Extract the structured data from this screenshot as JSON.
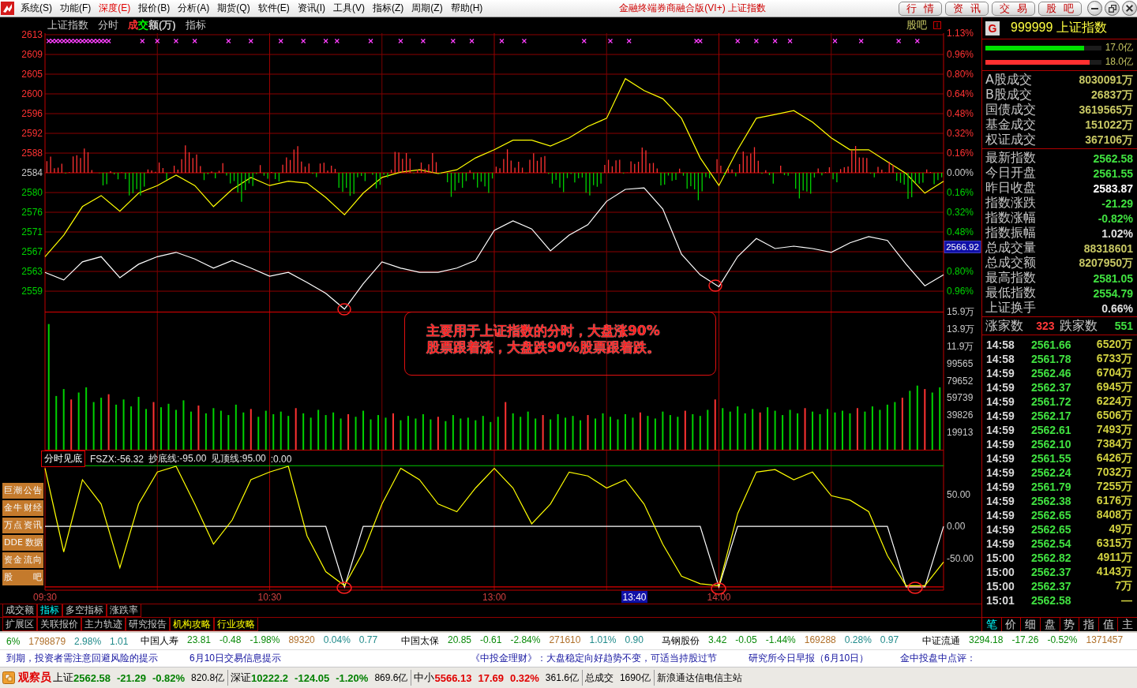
{
  "menu_bar": {
    "items": [
      {
        "label": "系统(S)",
        "highlighted": false
      },
      {
        "label": "功能(F)",
        "highlighted": false
      },
      {
        "label": "深度(E)",
        "highlighted": true
      },
      {
        "label": "报价(B)",
        "highlighted": false
      },
      {
        "label": "分析(A)",
        "highlighted": false
      },
      {
        "label": "期货(Q)",
        "highlighted": false
      },
      {
        "label": "软件(E)",
        "highlighted": false
      },
      {
        "label": "资讯(I)",
        "highlighted": false
      },
      {
        "label": "工具(V)",
        "highlighted": false
      },
      {
        "label": "指标(Z)",
        "highlighted": false
      },
      {
        "label": "周期(Z)",
        "highlighted": false
      },
      {
        "label": "帮助(H)",
        "highlighted": false
      }
    ],
    "title": "金融终端券商融合版(VI+) 上证指数",
    "buttons": [
      "行情",
      "资讯",
      "交易",
      "股吧"
    ]
  },
  "chart_header": {
    "title": "上证指数",
    "mode": "分时",
    "legend_parts": [
      {
        "text": "成",
        "color": "#ff3232"
      },
      {
        "text": "交",
        "color": "#00ff00"
      },
      {
        "text": "额(万)",
        "color": "#c8c8c8"
      }
    ],
    "indicator": "指标",
    "forum": "股吧"
  },
  "price_chart": {
    "cursor_label": "2566.92",
    "chart_data": {
      "type": "line",
      "grid": true,
      "categories": [
        null,
        null,
        null,
        null,
        null,
        null,
        null,
        null,
        null,
        null,
        null,
        null,
        null,
        null,
        null,
        null,
        null,
        null,
        null,
        null,
        null,
        null,
        null,
        null,
        null,
        null,
        null,
        null,
        null,
        null,
        null,
        null,
        null,
        null,
        null,
        null,
        null,
        null,
        null,
        null,
        null,
        null,
        null,
        null,
        null,
        null,
        null,
        null,
        null
      ],
      "ylim": [
        2554.77,
        2613.14
      ],
      "y2lim": [
        -1.126,
        1.133
      ],
      "yticks": [
        {
          "value": 2612.81,
          "label": "2613"
        },
        {
          "value": 2608.67,
          "label": "2609"
        },
        {
          "value": 2604.54,
          "label": "2605"
        },
        {
          "value": 2600.41,
          "label": "2600"
        },
        {
          "value": 2596.27,
          "label": "2596"
        },
        {
          "value": 2592.14,
          "label": "2592"
        },
        {
          "value": 2588.0,
          "label": "2588"
        },
        {
          "value": 2583.87,
          "label": "2584"
        },
        {
          "value": 2579.73,
          "label": "2580"
        },
        {
          "value": 2575.6,
          "label": "2576"
        },
        {
          "value": 2571.47,
          "label": "2571"
        },
        {
          "value": 2567.33,
          "label": "2567"
        },
        {
          "value": 2563.2,
          "label": "2563"
        },
        {
          "value": 2559.06,
          "label": "2559"
        }
      ],
      "y2ticks": [
        {
          "value": 1.13,
          "label": "1.13%"
        },
        {
          "value": 0.96,
          "label": "0.96%"
        },
        {
          "value": 0.8,
          "label": "0.80%"
        },
        {
          "value": 0.64,
          "label": "0.64%"
        },
        {
          "value": 0.48,
          "label": "0.48%"
        },
        {
          "value": 0.32,
          "label": "0.32%"
        },
        {
          "value": 0.16,
          "label": "0.16%"
        },
        {
          "value": 0,
          "label": "0.00%"
        },
        {
          "value": -0.16,
          "label": "0.16%"
        },
        {
          "value": -0.32,
          "label": "0.32%"
        },
        {
          "value": -0.48,
          "label": "0.48%"
        },
        {
          "value": -0.8,
          "label": "0.80%"
        },
        {
          "value": -0.96,
          "label": "0.96%"
        }
      ],
      "series": [
        {
          "color": "#ffff00",
          "values": [
            2566.3,
            2570.8,
            2576.8,
            2579.1,
            2575.8,
            2579.6,
            2581.2,
            2583.4,
            2581.2,
            2576.8,
            2580.4,
            2582.9,
            2581.2,
            2582.1,
            2581.7,
            2578.7,
            2575.1,
            2579.6,
            2582.9,
            2584.0,
            2584.5,
            2583.7,
            2584.5,
            2587.0,
            2588.7,
            2590.7,
            2590.7,
            2589.5,
            2591.2,
            2593.6,
            2595.3,
            2603.6,
            2601.1,
            2599.4,
            2595.3,
            2587.0,
            2581.2,
            2588.7,
            2595.3,
            2596.1,
            2596.9,
            2594.5,
            2591.2,
            2588.7,
            2588.7,
            2586.2,
            2583.7,
            2579.6,
            2582.1
          ]
        },
        {
          "color": "#ffffff",
          "values": [
            2563.0,
            2561.4,
            2565.2,
            2566.3,
            2561.9,
            2564.7,
            2566.3,
            2567.2,
            2565.8,
            2563.9,
            2565.5,
            2563.9,
            2562.2,
            2563.0,
            2560.9,
            2558.6,
            2555.3,
            2560.6,
            2565.2,
            2563.9,
            2563.0,
            2563.0,
            2563.9,
            2565.5,
            2571.8,
            2573.8,
            2572.1,
            2567.5,
            2570.8,
            2573.0,
            2577.9,
            2580.4,
            2580.7,
            2576.3,
            2566.8,
            2562.5,
            2560.0,
            2566.3,
            2570.1,
            2568.0,
            2568.5,
            2568.0,
            2567.2,
            2569.2,
            2570.5,
            2569.7,
            2564.7,
            2560.2,
            2562.5
          ]
        }
      ],
      "ref_lines": [
        {
          "axis": "y",
          "value": 2583.87,
          "color": "#a00000"
        }
      ]
    }
  },
  "volume_chart": {
    "note": {
      "lines": [
        "主要用于上证指数的分时，大盘涨90%",
        "股票跟着涨，大盘跌90%股票跟着跌。"
      ]
    },
    "chart_data": {
      "type": "bar",
      "stacked": true,
      "grid": true,
      "ylim": [
        0,
        159304
      ],
      "y2lim": [
        0,
        15.9
      ],
      "yticks": [
        {
          "value": 19913,
          "label": "19913"
        },
        {
          "value": 39826,
          "label": "39826"
        },
        {
          "value": 59739,
          "label": "59739"
        },
        {
          "value": 79652,
          "label": "79652"
        },
        {
          "value": 99565,
          "label": "99565"
        }
      ],
      "y2ticks": [
        {
          "value": 11.9,
          "label": "11.9万"
        },
        {
          "value": 13.9,
          "label": "13.9万"
        },
        {
          "value": 15.9,
          "label": "15.9万"
        }
      ],
      "series": [
        {
          "color": "#ff3232",
          "values": [
            null,
            null,
            null,
            58000,
            null,
            null,
            null,
            null,
            64000,
            null,
            null,
            null,
            null,
            null,
            55000,
            null,
            null,
            null,
            null,
            null,
            51000,
            null,
            null,
            null,
            null,
            null,
            null,
            47000,
            null,
            null,
            null,
            null,
            null,
            48000,
            null,
            null,
            null,
            null,
            null,
            null,
            41000,
            null,
            null,
            null,
            null,
            null,
            42000,
            null,
            null,
            null,
            null,
            null,
            38000,
            null,
            null,
            null,
            null,
            null,
            null,
            null,
            null,
            55000,
            null,
            null,
            null,
            null,
            40000,
            null,
            null,
            null,
            null,
            null,
            40000,
            null,
            null,
            null,
            null,
            null,
            null,
            43000,
            null,
            null,
            null,
            null,
            null,
            45000,
            null,
            null,
            null,
            58000,
            null,
            null,
            null,
            null,
            null,
            43000,
            null,
            null,
            null,
            null,
            null,
            48000,
            null,
            null,
            null,
            null,
            null,
            null,
            48000,
            null,
            null,
            null,
            null,
            null,
            60000,
            null,
            null,
            70000,
            null,
            null
          ]
        },
        {
          "color": "#00d200",
          "values": [
            145000,
            62000,
            70000,
            null,
            66000,
            72000,
            55000,
            60000,
            null,
            52000,
            58000,
            50000,
            61000,
            47000,
            null,
            49000,
            53000,
            46000,
            57000,
            44000,
            null,
            42000,
            48000,
            45000,
            40000,
            52000,
            43000,
            null,
            38000,
            45000,
            41000,
            44000,
            39000,
            null,
            42000,
            37000,
            46000,
            40000,
            43000,
            36000,
            null,
            38000,
            45000,
            35000,
            40000,
            37000,
            null,
            34000,
            39000,
            36000,
            41000,
            35000,
            null,
            33000,
            40000,
            36000,
            37000,
            34000,
            39000,
            32000,
            38000,
            null,
            42000,
            38000,
            44000,
            36000,
            null,
            35000,
            41000,
            37000,
            39000,
            34000,
            null,
            36000,
            42000,
            38000,
            35000,
            41000,
            37000,
            null,
            39000,
            36000,
            44000,
            40000,
            38000,
            null,
            41000,
            39000,
            46000,
            null,
            48000,
            44000,
            50000,
            42000,
            47000,
            null,
            49000,
            45000,
            40000,
            46000,
            42000,
            null,
            44000,
            41000,
            47000,
            43000,
            45000,
            42000,
            null,
            44000,
            50000,
            46000,
            52000,
            55000,
            null,
            68000,
            74000,
            null,
            66000,
            72000
          ]
        }
      ]
    }
  },
  "indicator_chart": {
    "label": "分时见底",
    "legend": [
      "FSZX:-56.32",
      "抄底线:-95.00",
      "见顶线:95.00",
      ":0.00"
    ],
    "cursor_time": "13:40",
    "chart_data": {
      "type": "line",
      "grid": true,
      "categories": [
        "09:30",
        null,
        null,
        null,
        null,
        null,
        null,
        null,
        null,
        null,
        null,
        null,
        "10:30",
        null,
        null,
        null,
        null,
        null,
        null,
        null,
        null,
        null,
        null,
        null,
        "13:00",
        null,
        null,
        null,
        null,
        null,
        null,
        null,
        null,
        null,
        null,
        null,
        "14:00",
        null,
        null,
        null,
        null,
        null,
        null,
        null,
        null,
        null,
        null,
        null,
        null
      ],
      "ylim": [
        -100,
        120
      ],
      "yticks": [
        {
          "value": 50,
          "label": "50.00"
        },
        {
          "value": 0,
          "label": "0.00"
        },
        {
          "value": -50,
          "label": "-50.00"
        }
      ],
      "series": [
        {
          "color": "#ffffff",
          "values": [
            0,
            0,
            0,
            0,
            0,
            0,
            0,
            0,
            0,
            0,
            0,
            0,
            0,
            0,
            0,
            0,
            -95,
            0,
            0,
            0,
            0,
            0,
            0,
            0,
            0,
            0,
            0,
            0,
            0,
            0,
            0,
            0,
            0,
            0,
            0,
            0,
            -95,
            0,
            0,
            0,
            0,
            0,
            0,
            0,
            0,
            0,
            -95,
            -95,
            0
          ]
        },
        {
          "color": "#ffff00",
          "values": [
            91,
            -40,
            73,
            35,
            -65,
            35,
            85,
            94,
            35,
            -28,
            10,
            73,
            85,
            94,
            -15,
            -71,
            -93,
            -40,
            35,
            91,
            73,
            35,
            23,
            60,
            91,
            60,
            4,
            35,
            85,
            79,
            60,
            73,
            35,
            -28,
            -78,
            -90,
            -93,
            20,
            85,
            89,
            73,
            85,
            48,
            41,
            23,
            -46,
            -93,
            -93,
            -56
          ]
        }
      ],
      "ref_lines": [
        {
          "axis": "y",
          "value": 95,
          "color": "#00c800"
        },
        {
          "axis": "y",
          "value": -95,
          "color": "#e00000"
        }
      ]
    }
  },
  "side_buttons": [
    "巨潮公告",
    "金牛财经",
    "万点资讯",
    "DDE 数据",
    "资金流向",
    "股吧"
  ],
  "chart_tabs": [
    {
      "label": "成交额",
      "selected": false
    },
    {
      "label": "指标",
      "selected": true
    },
    {
      "label": "多空指标",
      "selected": false
    },
    {
      "label": "涨跌率",
      "selected": false
    }
  ],
  "extension_tabs": [
    {
      "label": "扩展区",
      "highlighted": false
    },
    {
      "label": "关联报价",
      "highlighted": false
    },
    {
      "label": "主力轨迹",
      "highlighted": false
    },
    {
      "label": "研究报告",
      "highlighted": false
    },
    {
      "label": "机构攻略",
      "highlighted": true
    },
    {
      "label": "行业攻略",
      "highlighted": true
    }
  ],
  "quote_panel": {
    "badge": "G",
    "title": "999999 上证指数",
    "flow_bars": [
      {
        "color": "#00e000",
        "level": 0.85,
        "value": "17.0亿"
      },
      {
        "color": "#ff3030",
        "level": 0.9,
        "value": "18.0亿"
      }
    ],
    "turnover": [
      {
        "label": "A股成交",
        "value": "8030091万"
      },
      {
        "label": "B股成交",
        "value": "26837万"
      },
      {
        "label": "国债成交",
        "value": "3619565万"
      },
      {
        "label": "基金成交",
        "value": "151022万"
      },
      {
        "label": "权证成交",
        "value": "367106万"
      }
    ],
    "stats": [
      {
        "label": "最新指数",
        "value": "2562.58",
        "color": "#40e040"
      },
      {
        "label": "今日开盘",
        "value": "2561.55",
        "color": "#40e040"
      },
      {
        "label": "昨日收盘",
        "value": "2583.87",
        "color": "#ffffff"
      },
      {
        "label": "指数涨跌",
        "value": "-21.29",
        "color": "#40e040"
      },
      {
        "label": "指数涨幅",
        "value": "-0.82%",
        "color": "#40e040"
      },
      {
        "label": "指数振幅",
        "value": "1.02%",
        "color": "#e0e0e0"
      },
      {
        "label": "总成交量",
        "value": "88318601",
        "color": "#c8c864"
      },
      {
        "label": "总成交额",
        "value": "8207950万",
        "color": "#c8c864"
      },
      {
        "label": "最高指数",
        "value": "2581.05",
        "color": "#40e040"
      },
      {
        "label": "最低指数",
        "value": "2554.79",
        "color": "#40e040"
      },
      {
        "label": "上证换手",
        "value": "0.66%",
        "color": "#e0e0e0"
      }
    ],
    "breadth": {
      "up_label": "涨家数",
      "up_count": "323",
      "down_label": "跌家数",
      "down_count": "551"
    },
    "trades": [
      {
        "time": "14:58",
        "price": "2561.66",
        "volume": "6520万"
      },
      {
        "time": "14:58",
        "price": "2561.78",
        "volume": "6733万"
      },
      {
        "time": "14:59",
        "price": "2562.46",
        "volume": "6704万"
      },
      {
        "time": "14:59",
        "price": "2562.37",
        "volume": "6945万"
      },
      {
        "time": "14:59",
        "price": "2561.72",
        "volume": "6224万"
      },
      {
        "time": "14:59",
        "price": "2562.17",
        "volume": "6506万"
      },
      {
        "time": "14:59",
        "price": "2562.61",
        "volume": "7493万"
      },
      {
        "time": "14:59",
        "price": "2562.10",
        "volume": "7384万"
      },
      {
        "time": "14:59",
        "price": "2561.55",
        "volume": "6426万"
      },
      {
        "time": "14:59",
        "price": "2562.24",
        "volume": "7032万"
      },
      {
        "time": "14:59",
        "price": "2561.79",
        "volume": "7255万"
      },
      {
        "time": "14:59",
        "price": "2562.38",
        "volume": "6176万"
      },
      {
        "time": "14:59",
        "price": "2562.65",
        "volume": "8408万"
      },
      {
        "time": "14:59",
        "price": "2562.65",
        "volume": "49万"
      },
      {
        "time": "14:59",
        "price": "2562.54",
        "volume": "6315万"
      },
      {
        "time": "15:00",
        "price": "2562.82",
        "volume": "4911万"
      },
      {
        "time": "15:00",
        "price": "2562.37",
        "volume": "4143万"
      },
      {
        "time": "15:00",
        "price": "2562.37",
        "volume": "7万"
      },
      {
        "time": "15:01",
        "price": "2562.58",
        "volume": "—"
      }
    ],
    "tabs": [
      {
        "label": "笔",
        "selected": true
      },
      {
        "label": "价",
        "selected": false
      },
      {
        "label": "细",
        "selected": false
      },
      {
        "label": "盘",
        "selected": false
      },
      {
        "label": "势",
        "selected": false
      },
      {
        "label": "指",
        "selected": false
      },
      {
        "label": "值",
        "selected": false
      },
      {
        "label": "主",
        "selected": false
      }
    ]
  },
  "ticker": [
    {
      "pct": "6%",
      "volume": "1798879",
      "turnover": "2.98%",
      "ratio": "1.01"
    },
    {
      "name": "中国人寿",
      "price": "23.81",
      "change": "-0.48",
      "pct": "-1.98%",
      "volume": "89320",
      "turnover": "0.04%",
      "ratio": "0.77"
    },
    {
      "name": "中国太保",
      "price": "20.85",
      "change": "-0.61",
      "pct": "-2.84%",
      "volume": "271610",
      "turnover": "1.01%",
      "ratio": "0.90"
    },
    {
      "name": "马钢股份",
      "price": "3.42",
      "change": "-0.05",
      "pct": "-1.44%",
      "volume": "169288",
      "turnover": "0.28%",
      "ratio": "0.97"
    },
    {
      "name": "中证流通",
      "price": "3294.18",
      "change": "-17.26",
      "pct": "-0.52%",
      "volume": "1371457"
    }
  ],
  "news": [
    "到期，投资者需注意回避风险的提示",
    "6月10日交易信息提示",
    "《中投金理财》：大盘稳定向好趋势不变，可适当持股过节",
    "研究所今日早报（6月10日）",
    "金中投盘中点评："
  ],
  "status_bar": {
    "title": "观察员",
    "markets": [
      {
        "name": "上证",
        "price": "2562.58",
        "change": "-21.29",
        "pct": "-0.82%",
        "amount": "820.8亿",
        "color": "#008000"
      },
      {
        "name": "深证",
        "price": "10222.2",
        "change": "-124.05",
        "pct": "-1.20%",
        "amount": "869.6亿",
        "color": "#008000"
      },
      {
        "name": "中小",
        "price": "5566.13",
        "change": "17.69",
        "pct": "0.32%",
        "amount": "361.6亿",
        "color": "#e00000"
      }
    ],
    "total_label": "总成交",
    "total": "1690亿",
    "server": "新浪通达信电信主站"
  }
}
